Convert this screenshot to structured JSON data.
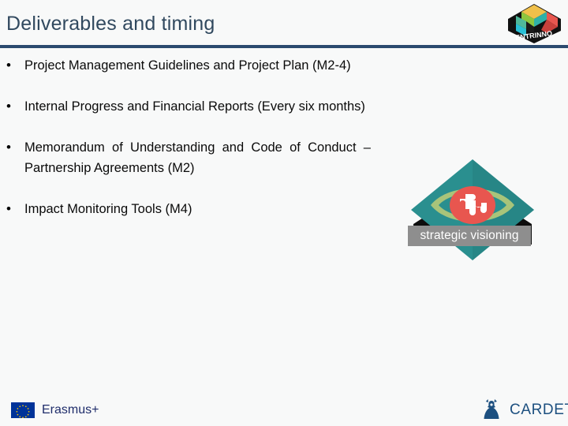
{
  "header": {
    "title": "Deliverables and timing",
    "rule_color": "#2b4a6f",
    "title_color": "#31495f"
  },
  "brand_logo": {
    "name": "entrinno-logo",
    "wordmark": "ENTRINNO",
    "colors": [
      "#f2c14e",
      "#f08a5d",
      "#e8505b",
      "#7fc8a9",
      "#3ec1d3",
      "#1a1a1a"
    ]
  },
  "content": {
    "bullets": [
      {
        "marker": "•",
        "text": "Project Management Guidelines and Project Plan (M2-4)",
        "justify": true
      },
      {
        "marker": "•",
        "text": "Internal Progress and Financial Reports (Every six months)",
        "justify": true
      },
      {
        "marker": "•",
        "text": "Memorandum of Understanding and Code of Conduct – Partnership Agreements (M2)",
        "justify": true
      },
      {
        "marker": "•",
        "text": "Impact Monitoring Tools (M4)",
        "justify": false
      }
    ]
  },
  "strategic_visioning": {
    "label": "strategic visioning",
    "diamond_color": "#2a8f8f",
    "diamond_shade": "#247c7c",
    "banner_color": "#8e8e8e",
    "eye_ring_color": "#a8c47a",
    "pupil_color": "#e8564f",
    "icon_name": "puzzle-piece-icon"
  },
  "footer": {
    "erasmus": {
      "label": "Erasmus+",
      "flag_name": "eu-flag-icon",
      "flag_color": "#003399",
      "star_color": "#ffcc00",
      "text_color": "#1f2d6b"
    },
    "cardet": {
      "label": "CARDET",
      "mark_color": "#1d5080",
      "text_color": "#1d5080"
    }
  },
  "background_color": "#f8f9f9"
}
